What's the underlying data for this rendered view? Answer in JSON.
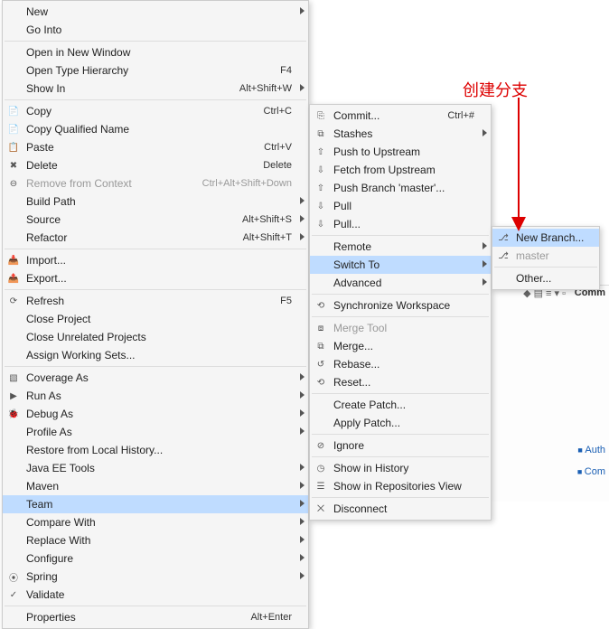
{
  "annotation": "创建分支",
  "bg": {
    "title": "Comm",
    "link_auth": "Auth",
    "link_com": "Com"
  },
  "menu1": {
    "items": [
      {
        "label": "New",
        "shortcut": "",
        "submenu": true,
        "icon": ""
      },
      {
        "label": "Go Into",
        "shortcut": "",
        "icon": ""
      },
      {
        "sep": true
      },
      {
        "label": "Open in New Window",
        "shortcut": "",
        "icon": ""
      },
      {
        "label": "Open Type Hierarchy",
        "shortcut": "F4",
        "icon": ""
      },
      {
        "label": "Show In",
        "shortcut": "Alt+Shift+W",
        "submenu": true,
        "icon": ""
      },
      {
        "sep": true
      },
      {
        "label": "Copy",
        "shortcut": "Ctrl+C",
        "icon": "📄"
      },
      {
        "label": "Copy Qualified Name",
        "shortcut": "",
        "icon": "📄"
      },
      {
        "label": "Paste",
        "shortcut": "Ctrl+V",
        "icon": "📋"
      },
      {
        "label": "Delete",
        "shortcut": "Delete",
        "icon": "✖"
      },
      {
        "label": "Remove from Context",
        "shortcut": "Ctrl+Alt+Shift+Down",
        "icon": "⊖",
        "disabled": true
      },
      {
        "label": "Build Path",
        "shortcut": "",
        "submenu": true,
        "icon": ""
      },
      {
        "label": "Source",
        "shortcut": "Alt+Shift+S",
        "submenu": true,
        "icon": ""
      },
      {
        "label": "Refactor",
        "shortcut": "Alt+Shift+T",
        "submenu": true,
        "icon": ""
      },
      {
        "sep": true
      },
      {
        "label": "Import...",
        "shortcut": "",
        "icon": "📥"
      },
      {
        "label": "Export...",
        "shortcut": "",
        "icon": "📤"
      },
      {
        "sep": true
      },
      {
        "label": "Refresh",
        "shortcut": "F5",
        "icon": "⟳"
      },
      {
        "label": "Close Project",
        "shortcut": "",
        "icon": ""
      },
      {
        "label": "Close Unrelated Projects",
        "shortcut": "",
        "icon": ""
      },
      {
        "label": "Assign Working Sets...",
        "shortcut": "",
        "icon": ""
      },
      {
        "sep": true
      },
      {
        "label": "Coverage As",
        "shortcut": "",
        "submenu": true,
        "icon": "▧"
      },
      {
        "label": "Run As",
        "shortcut": "",
        "submenu": true,
        "icon": "▶"
      },
      {
        "label": "Debug As",
        "shortcut": "",
        "submenu": true,
        "icon": "🐞"
      },
      {
        "label": "Profile As",
        "shortcut": "",
        "submenu": true,
        "icon": ""
      },
      {
        "label": "Restore from Local History...",
        "shortcut": "",
        "icon": ""
      },
      {
        "label": "Java EE Tools",
        "shortcut": "",
        "submenu": true,
        "icon": ""
      },
      {
        "label": "Maven",
        "shortcut": "",
        "submenu": true,
        "icon": ""
      },
      {
        "label": "Team",
        "shortcut": "",
        "submenu": true,
        "icon": "",
        "selected": true
      },
      {
        "label": "Compare With",
        "shortcut": "",
        "submenu": true,
        "icon": ""
      },
      {
        "label": "Replace With",
        "shortcut": "",
        "submenu": true,
        "icon": ""
      },
      {
        "label": "Configure",
        "shortcut": "",
        "submenu": true,
        "icon": ""
      },
      {
        "label": "Spring",
        "shortcut": "",
        "submenu": true,
        "icon": "⦿"
      },
      {
        "label": "Validate",
        "shortcut": "",
        "icon": "✓"
      },
      {
        "sep": true
      },
      {
        "label": "Properties",
        "shortcut": "Alt+Enter",
        "icon": ""
      }
    ]
  },
  "menu2": {
    "items": [
      {
        "label": "Commit...",
        "shortcut": "Ctrl+#",
        "icon": "⎘"
      },
      {
        "label": "Stashes",
        "shortcut": "",
        "submenu": true,
        "icon": "⧉"
      },
      {
        "label": "Push to Upstream",
        "shortcut": "",
        "icon": "⇧"
      },
      {
        "label": "Fetch from Upstream",
        "shortcut": "",
        "icon": "⇩"
      },
      {
        "label": "Push Branch 'master'...",
        "shortcut": "",
        "icon": "⇧"
      },
      {
        "label": "Pull",
        "shortcut": "",
        "icon": "⇩"
      },
      {
        "label": "Pull...",
        "shortcut": "",
        "icon": "⇩"
      },
      {
        "sep": true
      },
      {
        "label": "Remote",
        "shortcut": "",
        "submenu": true,
        "icon": ""
      },
      {
        "label": "Switch To",
        "shortcut": "",
        "submenu": true,
        "icon": "",
        "selected": true
      },
      {
        "label": "Advanced",
        "shortcut": "",
        "submenu": true,
        "icon": ""
      },
      {
        "sep": true
      },
      {
        "label": "Synchronize Workspace",
        "shortcut": "",
        "icon": "⟲"
      },
      {
        "sep": true
      },
      {
        "label": "Merge Tool",
        "shortcut": "",
        "icon": "⧈",
        "disabled": true
      },
      {
        "label": "Merge...",
        "shortcut": "",
        "icon": "⧉"
      },
      {
        "label": "Rebase...",
        "shortcut": "",
        "icon": "↺"
      },
      {
        "label": "Reset...",
        "shortcut": "",
        "icon": "⟲"
      },
      {
        "sep": true
      },
      {
        "label": "Create Patch...",
        "shortcut": "",
        "icon": ""
      },
      {
        "label": "Apply Patch...",
        "shortcut": "",
        "icon": ""
      },
      {
        "sep": true
      },
      {
        "label": "Ignore",
        "shortcut": "",
        "icon": "⊘"
      },
      {
        "sep": true
      },
      {
        "label": "Show in History",
        "shortcut": "",
        "icon": "◷"
      },
      {
        "label": "Show in Repositories View",
        "shortcut": "",
        "icon": "☰"
      },
      {
        "sep": true
      },
      {
        "label": "Disconnect",
        "shortcut": "",
        "icon": "⨉"
      }
    ]
  },
  "menu3": {
    "items": [
      {
        "label": "New Branch...",
        "icon": "⎇",
        "selected": true
      },
      {
        "label": "master",
        "icon": "⎇",
        "disabled": true
      },
      {
        "sep": true
      },
      {
        "label": "Other...",
        "icon": ""
      }
    ]
  }
}
